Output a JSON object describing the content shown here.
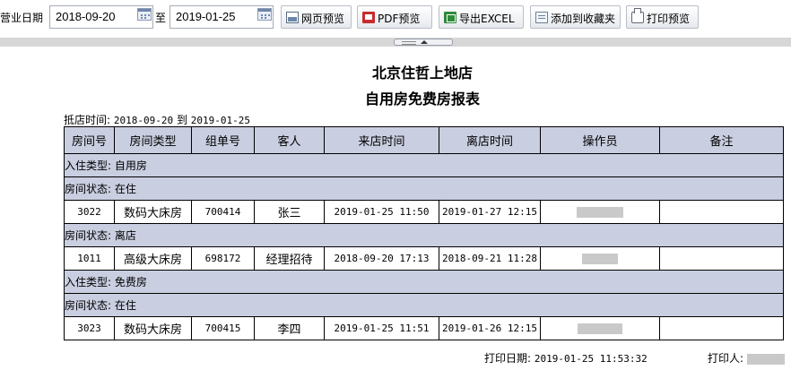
{
  "toolbar": {
    "business_date_label": "营业日期",
    "start_date": "2018-09-20",
    "to_label": "至",
    "end_date": "2019-01-25",
    "buttons": {
      "web_preview": "网页预览",
      "pdf_preview": "PDF预览",
      "export_excel": "导出EXCEL",
      "add_favorite": "添加到收藏夹",
      "print_preview": "打印预览"
    }
  },
  "report": {
    "hotel_name": "北京住哲上地店",
    "title": "自用房免费房报表",
    "range_label": "抵店时间:",
    "range_start": "2018-09-20",
    "range_to": "到",
    "range_end": "2019-01-25",
    "columns": [
      "房间号",
      "房间类型",
      "组单号",
      "客人",
      "来店时间",
      "离店时间",
      "操作员",
      "备注"
    ],
    "groups": {
      "type_self_use": "入住类型: 自用房",
      "status_in_1": "房间状态: 在住",
      "status_out": "房间状态: 离店",
      "type_free": "入住类型: 免费房",
      "status_in_2": "房间状态: 在住"
    },
    "rows": [
      {
        "room": "3022",
        "room_type": "数码大床房",
        "order": "700414",
        "guest": "张三",
        "arrive": "2019-01-25 11:50",
        "depart": "2019-01-27 12:15",
        "operator": "",
        "note": ""
      },
      {
        "room": "1011",
        "room_type": "高级大床房",
        "order": "698172",
        "guest": "经理招待",
        "arrive": "2018-09-20 17:13",
        "depart": "2018-09-21 11:28",
        "operator": "",
        "note": ""
      },
      {
        "room": "3023",
        "room_type": "数码大床房",
        "order": "700415",
        "guest": "李四",
        "arrive": "2019-01-25 11:51",
        "depart": "2019-01-26 12:15",
        "operator": "",
        "note": ""
      }
    ],
    "print_date_label": "打印日期:",
    "print_date": "2019-01-25 11:53:32",
    "printer_label": "打印人:"
  }
}
